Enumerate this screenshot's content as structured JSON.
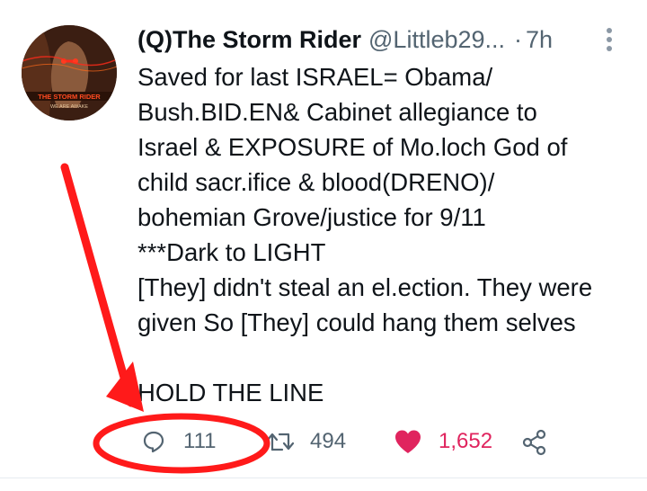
{
  "tweet": {
    "display_name": "(Q)The Storm Rider",
    "handle": "@Littleb29...",
    "separator": "·",
    "time": "7h",
    "text_lines": [
      "Saved for last ISRAEL= Obama/",
      "Bush.BID.EN& Cabinet allegiance to",
      "Israel & EXPOSURE of Mo.loch God of",
      "child sacr.ifice & blood(DRENO)/",
      "bohemian Grove/justice for 9/11",
      "***Dark to LIGHT",
      "[They] didn't steal an el.ection. They were",
      "given So [They] could hang them selves",
      "",
      "HOLD THE LINE"
    ],
    "avatar": {
      "banner_text": "THE STORM RIDER",
      "subtext": "WE ARE AWAKE"
    }
  },
  "actions": {
    "reply_count": "111",
    "retweet_count": "494",
    "like_count": "1,652",
    "reply_icon": "reply-icon",
    "retweet_icon": "retweet-icon",
    "like_icon": "heart-icon",
    "share_icon": "share-icon"
  },
  "colors": {
    "like": "#e0245e",
    "muted": "#536471",
    "text": "#0f1419",
    "annotation": "#ff1a1a"
  }
}
